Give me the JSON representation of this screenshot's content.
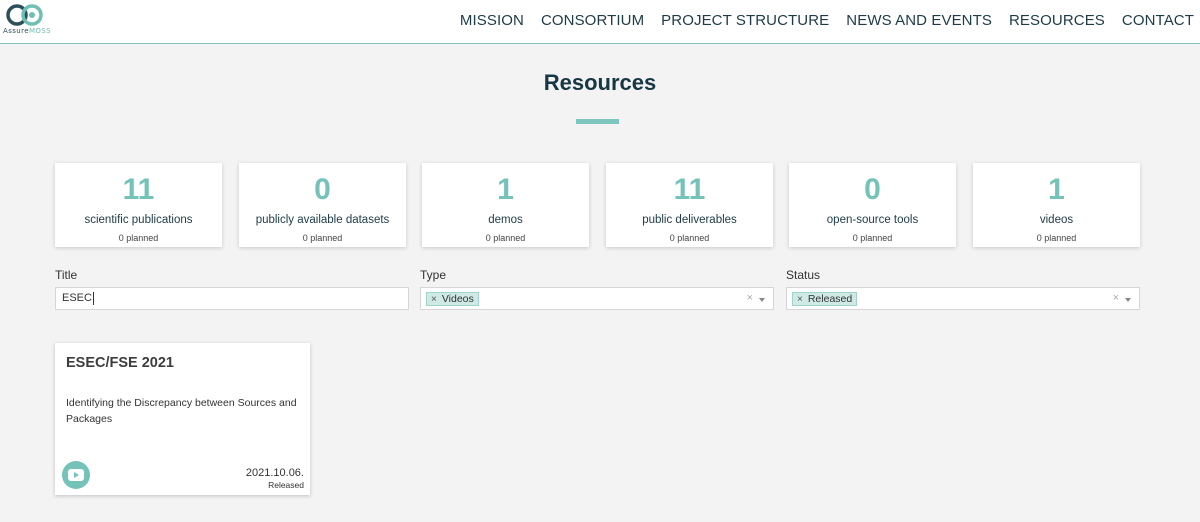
{
  "header": {
    "logo_icon": "infinity-logo-icon",
    "logo_text_main": "Assure",
    "logo_text_accent": "MOSS",
    "nav": [
      "MISSION",
      "CONSORTIUM",
      "PROJECT STRUCTURE",
      "NEWS AND EVENTS",
      "RESOURCES",
      "CONTACT"
    ]
  },
  "page": {
    "title": "Resources"
  },
  "stats": [
    {
      "value": "11",
      "label": "scientific publications",
      "planned": "0 planned"
    },
    {
      "value": "0",
      "label": "publicly available datasets",
      "planned": "0 planned"
    },
    {
      "value": "1",
      "label": "demos",
      "planned": "0 planned"
    },
    {
      "value": "11",
      "label": "public deliverables",
      "planned": "0 planned"
    },
    {
      "value": "0",
      "label": "open-source tools",
      "planned": "0 planned"
    },
    {
      "value": "1",
      "label": "videos",
      "planned": "0 planned"
    }
  ],
  "filters": {
    "title_label": "Title",
    "title_value": "ESEC",
    "type_label": "Type",
    "type_chip": "Videos",
    "status_label": "Status",
    "status_chip": "Released",
    "chip_remove": "×",
    "clear": "×"
  },
  "results": [
    {
      "title": "ESEC/FSE 2021",
      "description": "Identifying the Discrepancy between Sources and Packages",
      "icon": "video-play-icon",
      "date": "2021.10.06.",
      "status": "Released"
    }
  ],
  "colors": {
    "accent": "#74c2b8",
    "heading": "#163743",
    "nav": "#1d3b47",
    "background": "#f3f3f3"
  }
}
